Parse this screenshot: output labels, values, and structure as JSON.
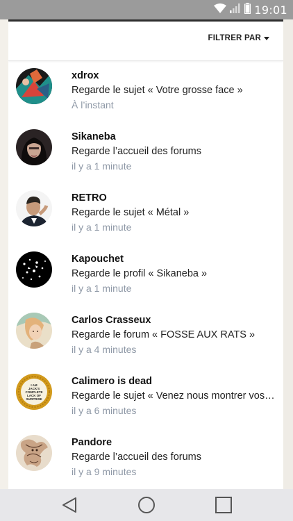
{
  "status_bar": {
    "time": "19:01",
    "icons": [
      "wifi-icon",
      "signal-icon",
      "battery-icon"
    ]
  },
  "filter": {
    "label": "FILTRER PAR"
  },
  "activities": [
    {
      "user": "xdrox",
      "action": "Regarde le sujet « Votre grosse face »",
      "time": "À l’instant"
    },
    {
      "user": "Sikaneba",
      "action": "Regarde l’accueil des forums",
      "time": "il y a 1 minute"
    },
    {
      "user": "RETRO",
      "action": "Regarde le sujet « Métal »",
      "time": "il y a 1 minute"
    },
    {
      "user": "Kapouchet",
      "action": "Regarde le profil « Sikaneba »",
      "time": "il y a 1 minute"
    },
    {
      "user": "Carlos Crasseux",
      "action": "Regarde le forum « FOSSE AUX RATS »",
      "time": "il y a 4 minutes"
    },
    {
      "user": "Calimero is dead",
      "action": "Regarde le sujet « Venez nous montrer vos…",
      "time": "il y a 6 minutes"
    },
    {
      "user": "Pandore",
      "action": "Regarde l’accueil des forums",
      "time": "il y a 9 minutes"
    }
  ],
  "avatar_6_text": "I AM JACK'S COMPLETE LACK OF SURPRISE",
  "colors": {
    "status_bar": "#9b9b9b",
    "timestamp": "#8e98a6",
    "nav_bar": "#e7e7ea"
  },
  "nav_icons": [
    "back-icon",
    "home-icon",
    "recents-icon"
  ]
}
